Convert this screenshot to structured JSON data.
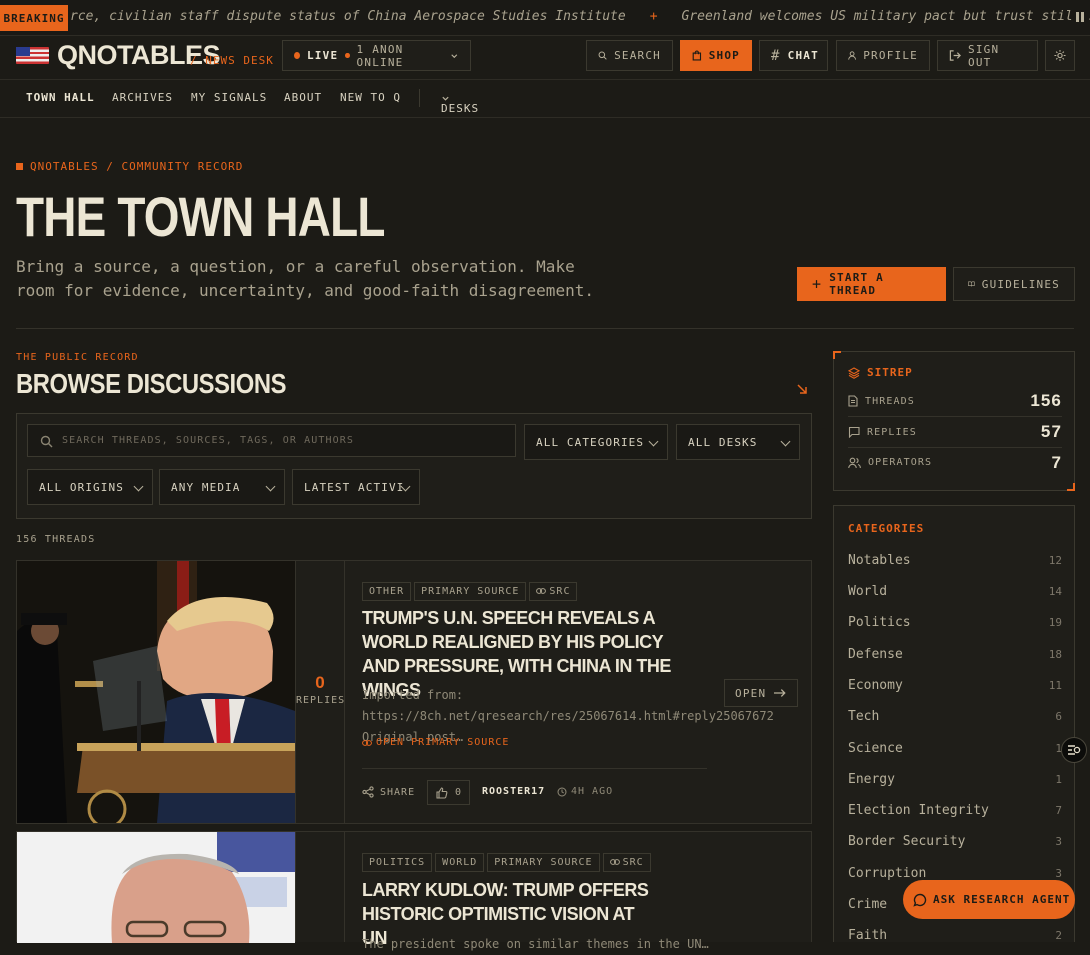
{
  "ticker": {
    "label": "BREAKING",
    "items": [
      "rce, civilian staff dispute status of China Aerospace Studies Institute",
      "Greenland welcomes US military pact but trust still shaky"
    ],
    "sep": "+"
  },
  "header": {
    "logo": "QNOTABLES",
    "desk": "/ NEWS DESK",
    "live": "LIVE",
    "online": "1 ANON ONLINE",
    "search": "SEARCH",
    "shop": "SHOP",
    "chat": "CHAT",
    "profile": "PROFILE",
    "signout": "SIGN OUT"
  },
  "nav": [
    "TOWN HALL",
    "ARCHIVES",
    "MY SIGNALS",
    "ABOUT",
    "NEW TO Q",
    "DESKS"
  ],
  "page": {
    "breadcrumb": "QNOTABLES / COMMUNITY RECORD",
    "title": "THE TOWN HALL",
    "intro": "Bring a source, a question, or a careful observation. Make room for evidence, uncertainty, and good-faith disagreement.",
    "start_thread": "START A THREAD",
    "guidelines": "GUIDELINES",
    "eyebrow": "THE PUBLIC RECORD",
    "browse": "BROWSE DISCUSSIONS",
    "count": "156 THREADS"
  },
  "filters": {
    "search_placeholder": "SEARCH THREADS, SOURCES, TAGS, OR AUTHORS",
    "categories": "ALL CATEGORIES",
    "desks": "ALL DESKS",
    "origins": "ALL ORIGINS",
    "media": "ANY MEDIA",
    "sort": "LATEST ACTIVI"
  },
  "threads": [
    {
      "tags": [
        "OTHER",
        "PRIMARY SOURCE",
        "SRC"
      ],
      "title": "TRUMP'S U.N. SPEECH REVEALS A WORLD REALIGNED BY HIS POLICY AND PRESSURE, WITH CHINA IN THE WINGS",
      "replies": "0",
      "replies_label": "REPLIES",
      "excerpt": "Imported from: https://8ch.net/qresearch/res/25067614.html#reply25067672 Original post…",
      "source_link": "OPEN PRIMARY SOURCE",
      "open": "OPEN",
      "share": "SHARE",
      "likes": "0",
      "author": "ROOSTER17",
      "time": "4H AGO"
    },
    {
      "tags": [
        "POLITICS",
        "WORLD",
        "PRIMARY SOURCE",
        "SRC"
      ],
      "title": "LARRY KUDLOW: TRUMP OFFERS HISTORIC OPTIMISTIC VISION AT UN",
      "excerpt": "The president spoke on similar themes in the UN…"
    }
  ],
  "sitrep": {
    "title": "SITREP",
    "rows": [
      {
        "label": "THREADS",
        "value": "156"
      },
      {
        "label": "REPLIES",
        "value": "57"
      },
      {
        "label": "OPERATORS",
        "value": "7"
      }
    ]
  },
  "categories": {
    "title": "CATEGORIES",
    "items": [
      {
        "name": "Notables",
        "count": "12"
      },
      {
        "name": "World",
        "count": "14"
      },
      {
        "name": "Politics",
        "count": "19"
      },
      {
        "name": "Defense",
        "count": "18"
      },
      {
        "name": "Economy",
        "count": "11"
      },
      {
        "name": "Tech",
        "count": "6"
      },
      {
        "name": "Science",
        "count": "1"
      },
      {
        "name": "Energy",
        "count": "1"
      },
      {
        "name": "Election Integrity",
        "count": "7"
      },
      {
        "name": "Border Security",
        "count": "3"
      },
      {
        "name": "Corruption",
        "count": "3"
      },
      {
        "name": "Crime",
        "count": "1"
      },
      {
        "name": "Faith",
        "count": "2"
      }
    ]
  },
  "agent": {
    "label": "ASK RESEARCH AGENT"
  }
}
